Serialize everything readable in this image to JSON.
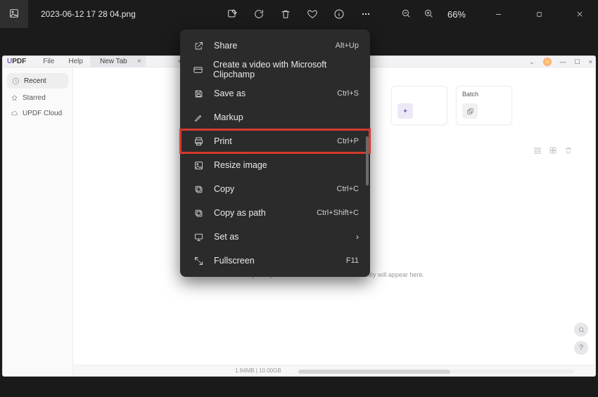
{
  "photos": {
    "filename": "2023-06-12 17 28 04.png",
    "zoom": "66%"
  },
  "updf": {
    "logo_a": "U",
    "logo_b": "PDF",
    "menu": {
      "file": "File",
      "help": "Help"
    },
    "tab": {
      "label": "New Tab"
    },
    "sidebar": {
      "recent": "Recent",
      "starred": "Starred",
      "cloud": "UPDF Cloud"
    },
    "cards": {
      "c1": "",
      "c2": "Batch"
    },
    "empty": "Any files you've viewed or worked with recently will appear here.",
    "status": "1.94MB | 10.00GB"
  },
  "menu": {
    "items": [
      {
        "label": "Share",
        "shortcut": "Alt+Up"
      },
      {
        "label": "Create a video with Microsoft Clipchamp",
        "shortcut": ""
      },
      {
        "label": "Save as",
        "shortcut": "Ctrl+S"
      },
      {
        "label": "Markup",
        "shortcut": ""
      },
      {
        "label": "Print",
        "shortcut": "Ctrl+P"
      },
      {
        "label": "Resize image",
        "shortcut": ""
      },
      {
        "label": "Copy",
        "shortcut": "Ctrl+C"
      },
      {
        "label": "Copy as path",
        "shortcut": "Ctrl+Shift+C"
      },
      {
        "label": "Set as",
        "shortcut": "",
        "submenu": true
      },
      {
        "label": "Fullscreen",
        "shortcut": "F11"
      }
    ]
  }
}
